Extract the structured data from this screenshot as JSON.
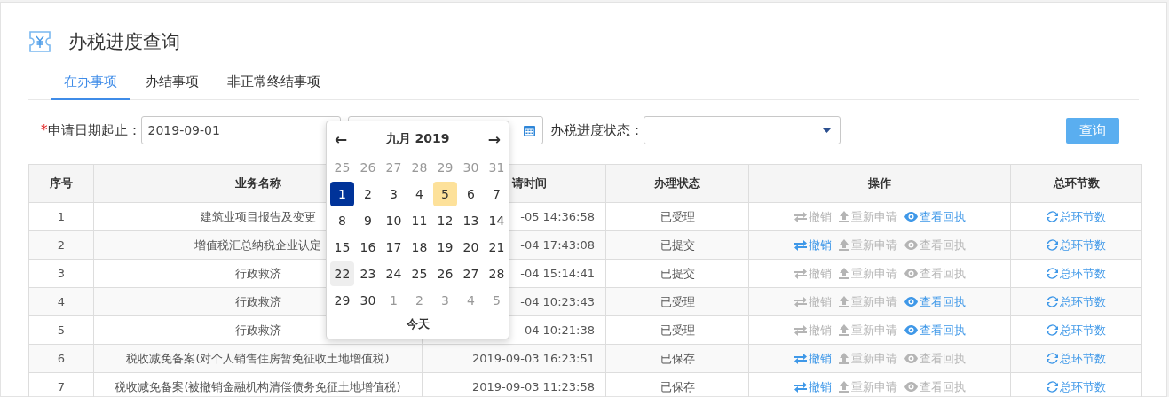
{
  "page": {
    "title": "办税进度查询"
  },
  "tabs": [
    {
      "label": "在办事项",
      "selected": true
    },
    {
      "label": "办结事项",
      "selected": false
    },
    {
      "label": "非正常终结事项",
      "selected": false
    }
  ],
  "filters": {
    "date_label": "申请日期起止：",
    "required_mark": "*",
    "date_from": "2019-09-01",
    "status_label": "办税进度状态：",
    "query_button": "查询"
  },
  "datepicker": {
    "month": "九月 2019",
    "prev": "←",
    "next": "→",
    "today_button": "今天",
    "days": [
      {
        "label": "25",
        "muted": true,
        "selected": false,
        "today": false,
        "hover": false
      },
      {
        "label": "26",
        "muted": true,
        "selected": false,
        "today": false,
        "hover": false
      },
      {
        "label": "27",
        "muted": true,
        "selected": false,
        "today": false,
        "hover": false
      },
      {
        "label": "28",
        "muted": true,
        "selected": false,
        "today": false,
        "hover": false
      },
      {
        "label": "29",
        "muted": true,
        "selected": false,
        "today": false,
        "hover": false
      },
      {
        "label": "30",
        "muted": true,
        "selected": false,
        "today": false,
        "hover": false
      },
      {
        "label": "31",
        "muted": true,
        "selected": false,
        "today": false,
        "hover": false
      },
      {
        "label": "1",
        "muted": false,
        "selected": true,
        "today": false,
        "hover": false
      },
      {
        "label": "2",
        "muted": false,
        "selected": false,
        "today": false,
        "hover": false
      },
      {
        "label": "3",
        "muted": false,
        "selected": false,
        "today": false,
        "hover": false
      },
      {
        "label": "4",
        "muted": false,
        "selected": false,
        "today": false,
        "hover": false
      },
      {
        "label": "5",
        "muted": false,
        "selected": false,
        "today": true,
        "hover": false
      },
      {
        "label": "6",
        "muted": false,
        "selected": false,
        "today": false,
        "hover": false
      },
      {
        "label": "7",
        "muted": false,
        "selected": false,
        "today": false,
        "hover": false
      },
      {
        "label": "8",
        "muted": false,
        "selected": false,
        "today": false,
        "hover": false
      },
      {
        "label": "9",
        "muted": false,
        "selected": false,
        "today": false,
        "hover": false
      },
      {
        "label": "10",
        "muted": false,
        "selected": false,
        "today": false,
        "hover": false
      },
      {
        "label": "11",
        "muted": false,
        "selected": false,
        "today": false,
        "hover": false
      },
      {
        "label": "12",
        "muted": false,
        "selected": false,
        "today": false,
        "hover": false
      },
      {
        "label": "13",
        "muted": false,
        "selected": false,
        "today": false,
        "hover": false
      },
      {
        "label": "14",
        "muted": false,
        "selected": false,
        "today": false,
        "hover": false
      },
      {
        "label": "15",
        "muted": false,
        "selected": false,
        "today": false,
        "hover": false
      },
      {
        "label": "16",
        "muted": false,
        "selected": false,
        "today": false,
        "hover": false
      },
      {
        "label": "17",
        "muted": false,
        "selected": false,
        "today": false,
        "hover": false
      },
      {
        "label": "18",
        "muted": false,
        "selected": false,
        "today": false,
        "hover": false
      },
      {
        "label": "19",
        "muted": false,
        "selected": false,
        "today": false,
        "hover": false
      },
      {
        "label": "20",
        "muted": false,
        "selected": false,
        "today": false,
        "hover": false
      },
      {
        "label": "21",
        "muted": false,
        "selected": false,
        "today": false,
        "hover": false
      },
      {
        "label": "22",
        "muted": false,
        "selected": false,
        "today": false,
        "hover": true
      },
      {
        "label": "23",
        "muted": false,
        "selected": false,
        "today": false,
        "hover": false
      },
      {
        "label": "24",
        "muted": false,
        "selected": false,
        "today": false,
        "hover": false
      },
      {
        "label": "25",
        "muted": false,
        "selected": false,
        "today": false,
        "hover": false
      },
      {
        "label": "26",
        "muted": false,
        "selected": false,
        "today": false,
        "hover": false
      },
      {
        "label": "27",
        "muted": false,
        "selected": false,
        "today": false,
        "hover": false
      },
      {
        "label": "28",
        "muted": false,
        "selected": false,
        "today": false,
        "hover": false
      },
      {
        "label": "29",
        "muted": false,
        "selected": false,
        "today": false,
        "hover": false
      },
      {
        "label": "30",
        "muted": false,
        "selected": false,
        "today": false,
        "hover": false
      },
      {
        "label": "1",
        "muted": true,
        "selected": false,
        "today": false,
        "hover": false
      },
      {
        "label": "2",
        "muted": true,
        "selected": false,
        "today": false,
        "hover": false
      },
      {
        "label": "3",
        "muted": true,
        "selected": false,
        "today": false,
        "hover": false
      },
      {
        "label": "4",
        "muted": true,
        "selected": false,
        "today": false,
        "hover": false
      },
      {
        "label": "5",
        "muted": true,
        "selected": false,
        "today": false,
        "hover": false
      }
    ]
  },
  "table": {
    "columns": [
      "序号",
      "业务名称",
      "请时间",
      "办理状态",
      "操作",
      "总环节数"
    ],
    "rows": [
      {
        "no": "1",
        "name": "建筑业项目报告及变更",
        "time": "-05 14:36:58",
        "status": "已受理",
        "actions": [
          {
            "kind": "revoke",
            "label": "撤销",
            "enabled": false
          },
          {
            "kind": "resubmit",
            "label": "重新申请",
            "enabled": false
          },
          {
            "kind": "receipt",
            "label": "查看回执",
            "enabled": true
          }
        ],
        "steps": "总环节数"
      },
      {
        "no": "2",
        "name": "增值税汇总纳税企业认定",
        "time": "-04 17:43:08",
        "status": "已提交",
        "actions": [
          {
            "kind": "revoke",
            "label": "撤销",
            "enabled": true
          },
          {
            "kind": "resubmit",
            "label": "重新申请",
            "enabled": false
          },
          {
            "kind": "receipt",
            "label": "查看回执",
            "enabled": false
          }
        ],
        "steps": "总环节数"
      },
      {
        "no": "3",
        "name": "行政救济",
        "time": "-04 15:14:41",
        "status": "已提交",
        "actions": [
          {
            "kind": "revoke",
            "label": "撤销",
            "enabled": false
          },
          {
            "kind": "resubmit",
            "label": "重新申请",
            "enabled": false
          },
          {
            "kind": "receipt",
            "label": "查看回执",
            "enabled": false
          }
        ],
        "steps": "总环节数"
      },
      {
        "no": "4",
        "name": "行政救济",
        "time": "-04 10:23:43",
        "status": "已受理",
        "actions": [
          {
            "kind": "revoke",
            "label": "撤销",
            "enabled": false
          },
          {
            "kind": "resubmit",
            "label": "重新申请",
            "enabled": false
          },
          {
            "kind": "receipt",
            "label": "查看回执",
            "enabled": true
          }
        ],
        "steps": "总环节数"
      },
      {
        "no": "5",
        "name": "行政救济",
        "time": "-04 10:21:38",
        "status": "已受理",
        "actions": [
          {
            "kind": "revoke",
            "label": "撤销",
            "enabled": false
          },
          {
            "kind": "resubmit",
            "label": "重新申请",
            "enabled": false
          },
          {
            "kind": "receipt",
            "label": "查看回执",
            "enabled": true
          }
        ],
        "steps": "总环节数"
      },
      {
        "no": "6",
        "name": "税收减免备案(对个人销售住房暂免征收土地增值税)",
        "time": "2019-09-03 16:23:51",
        "status": "已保存",
        "actions": [
          {
            "kind": "revoke",
            "label": "撤销",
            "enabled": true
          },
          {
            "kind": "resubmit",
            "label": "重新申请",
            "enabled": false
          },
          {
            "kind": "receipt",
            "label": "查看回执",
            "enabled": false
          }
        ],
        "steps": "总环节数"
      },
      {
        "no": "7",
        "name": "税收减免备案(被撤销金融机构清偿债务免征土地增值税)",
        "time": "2019-09-03 11:23:58",
        "status": "已保存",
        "actions": [
          {
            "kind": "revoke",
            "label": "撤销",
            "enabled": true
          },
          {
            "kind": "resubmit",
            "label": "重新申请",
            "enabled": false
          },
          {
            "kind": "receipt",
            "label": "查看回执",
            "enabled": false
          }
        ],
        "steps": "总环节数"
      }
    ]
  }
}
